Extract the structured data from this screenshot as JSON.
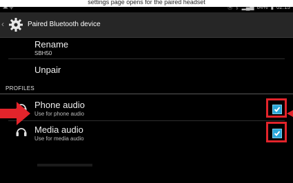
{
  "caption": "settings page opens for the paired headset",
  "status_bar": {
    "battery": "84%",
    "time": "02:15"
  },
  "action_bar": {
    "title": "Paired Bluetooth device"
  },
  "rename": {
    "title": "Rename",
    "value": "SBH50"
  },
  "unpair": {
    "title": "Unpair"
  },
  "profiles": {
    "header": "PROFILES",
    "items": [
      {
        "title": "Phone audio",
        "subtitle": "Use for phone audio",
        "checked": true
      },
      {
        "title": "Media audio",
        "subtitle": "Use for media audio",
        "checked": true
      }
    ]
  },
  "colors": {
    "accent": "#2aa7d9",
    "highlight": "#e3242b",
    "background": "#000000"
  }
}
